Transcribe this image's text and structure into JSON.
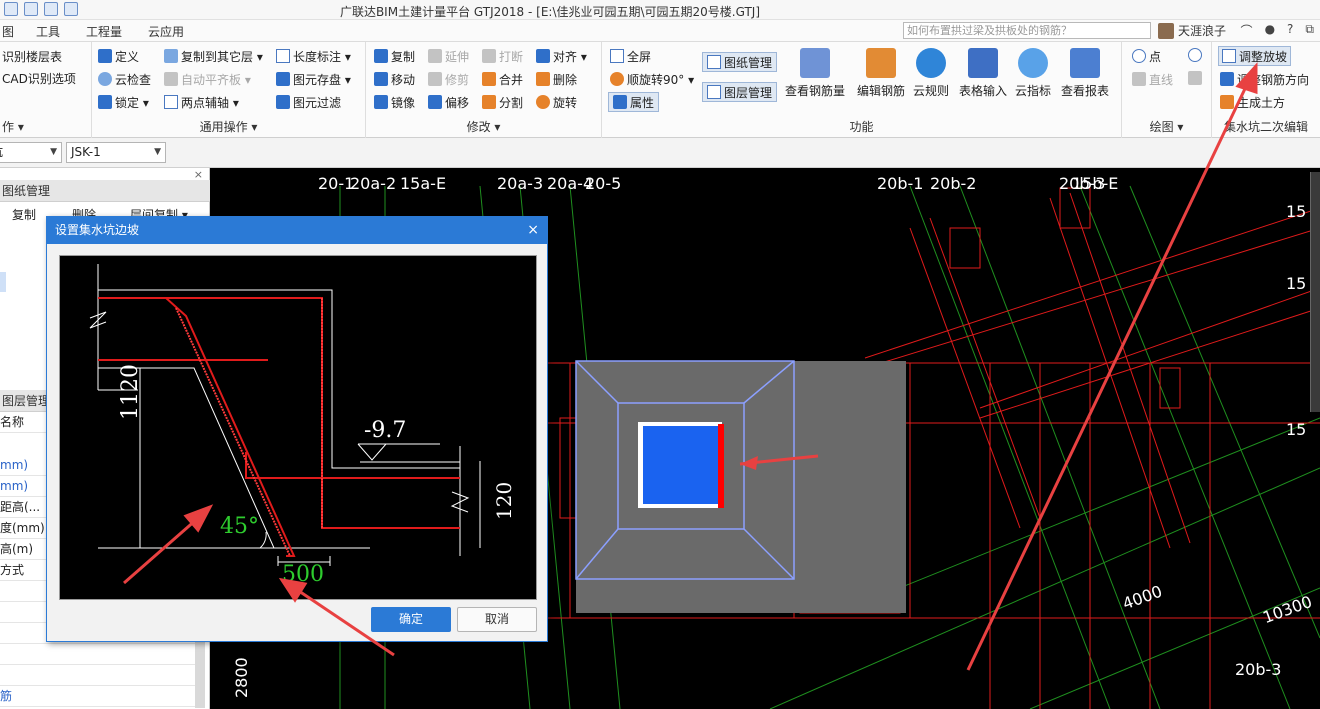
{
  "window": {
    "title": "广联达BIM土建计量平台 GTJ2018 - [E:\\佳兆业可园五期\\可园五期20号楼.GTJ]"
  },
  "menu": {
    "items": [
      "图",
      "工具",
      "工程量",
      "云应用"
    ],
    "search_placeholder": "如何布置拱过梁及拱板处的钢筋？",
    "user": "天涯浪子",
    "controls": [
      "⌒",
      "●",
      "?",
      "⧉"
    ]
  },
  "ribbon": {
    "g0": {
      "items": [
        "识别楼层表",
        "CAD识别选项"
      ],
      "label": "作 ▾"
    },
    "g1": {
      "items": [
        "定义",
        "复制到其它层 ▾",
        "长度标注 ▾",
        "云检查",
        "自动平齐板 ▾",
        "图元存盘 ▾",
        "锁定 ▾",
        "两点辅轴 ▾",
        "图元过滤"
      ],
      "label": "通用操作 ▾"
    },
    "g2": {
      "items": [
        "复制",
        "延伸",
        "打断",
        "对齐 ▾",
        "移动",
        "修剪",
        "合并",
        "删除",
        "镜像",
        "偏移",
        "分割",
        "旋转"
      ],
      "label": "修改 ▾"
    },
    "g3": {
      "small": [
        "全屏",
        "顺旋转90° ▾",
        "属性",
        "图纸管理",
        "图层管理"
      ],
      "big": [
        "查看钢筋量",
        "编辑钢筋",
        "云规则",
        "表格输入",
        "云指标",
        "查看报表"
      ],
      "label": "功能"
    },
    "g4": {
      "items": [
        "点",
        "直线"
      ],
      "label": "绘图 ▾"
    },
    "g5": {
      "items": [
        "调整放坡",
        "调整钢筋方向",
        "生成土方"
      ],
      "label": "集水坑二次编辑"
    }
  },
  "selectors": {
    "first": "坑",
    "second": "JSK-1"
  },
  "left_panel": {
    "drawings_title": "图纸管理",
    "drawings_tools": [
      "复制",
      "删除",
      "层间复制 ▾"
    ],
    "layers_title": "图层管理",
    "rows": [
      "名称",
      "mm)",
      "mm)",
      "距高(...",
      "度(mm)",
      "高(m)",
      "方式",
      "",
      "",
      "",
      "",
      "",
      "筋"
    ]
  },
  "canvas": {
    "labels": [
      "20-1",
      "20a-2",
      "15a-E",
      "20a-3",
      "20a-4",
      "20-5",
      "20b-1",
      "20b-2",
      "20b-3",
      "15b-E",
      "15",
      "15",
      "15",
      "4000",
      "10300",
      "20b-3",
      "2800"
    ]
  },
  "dialog": {
    "title": "设置集水坑边坡",
    "close": "×",
    "depth_label": "1120",
    "elevation_label": "-9.7",
    "right_label": "120",
    "angle_label": "45°",
    "width_label": "500",
    "ok": "确定",
    "cancel": "取消"
  },
  "colors": {
    "accent": "#2b7ad6",
    "rebar": "#e01b1b",
    "pit_fill": "#1a63f0",
    "grid_green": "#1f8f1f",
    "edge_blue": "#8ca0ff",
    "label_green": "#2ecc2e"
  }
}
